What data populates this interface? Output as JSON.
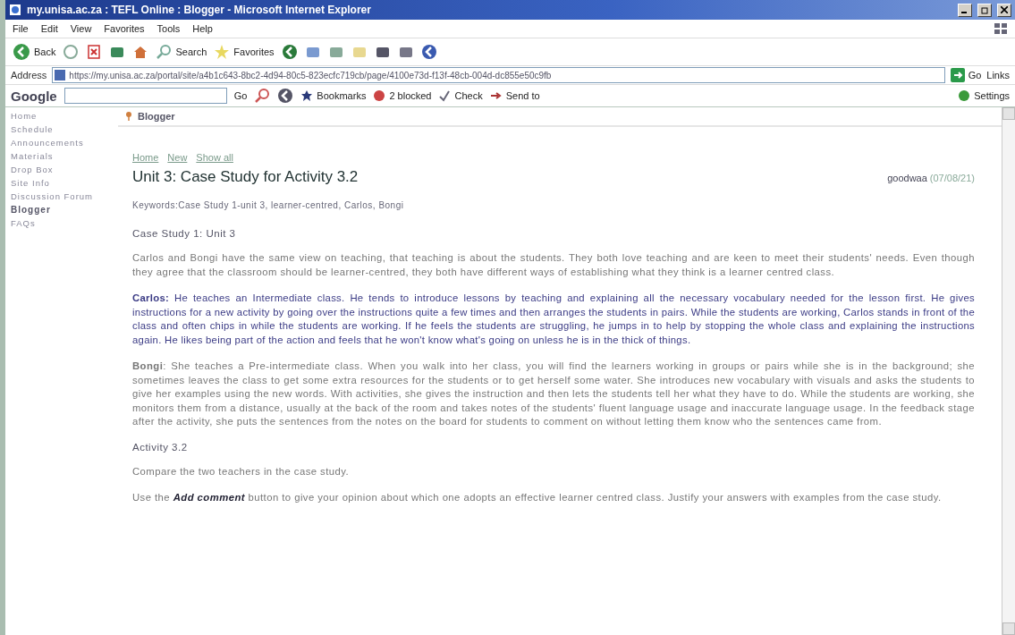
{
  "window": {
    "title": "my.unisa.ac.za : TEFL Online : Blogger - Microsoft Internet Explorer"
  },
  "menu": [
    "File",
    "Edit",
    "View",
    "Favorites",
    "Tools",
    "Help"
  ],
  "toolbar": {
    "back": "Back",
    "search": "Search",
    "favorites": "Favorites"
  },
  "address": {
    "label": "Address",
    "value": "https://my.unisa.ac.za/portal/site/a4b1c643-8bc2-4d94-80c5-823ecfc719cb/page/4100e73d-f13f-48cb-004d-dc855e50c9fb",
    "go": "Go",
    "links": "Links"
  },
  "google_bar": {
    "logo": "Google",
    "go": "Go",
    "bookmarks": "Bookmarks",
    "blocked": "2 blocked",
    "check": "Check",
    "send_to": "Send to",
    "settings": "Settings"
  },
  "sidebar": {
    "items": [
      {
        "label": "Home",
        "selected": false
      },
      {
        "label": "Schedule",
        "selected": false
      },
      {
        "label": "Announcements",
        "selected": false
      },
      {
        "label": "Materials",
        "selected": false
      },
      {
        "label": "Drop Box",
        "selected": false
      },
      {
        "label": "Site Info",
        "selected": false
      },
      {
        "label": "Discussion Forum",
        "selected": false
      },
      {
        "label": "Blogger",
        "selected": true
      },
      {
        "label": "FAQs",
        "selected": false
      }
    ]
  },
  "tool_title": "Blogger",
  "nav_links": [
    "Home",
    "New",
    "Show all"
  ],
  "post": {
    "title": "Unit 3: Case Study for Activity 3.2",
    "author": "goodwaa",
    "date": "(07/08/21)",
    "keywords": "Keywords:Case Study 1-unit 3, learner-centred, Carlos, Bongi",
    "body": [
      {
        "kind": "heading",
        "text": "Case Study 1: Unit 3"
      },
      {
        "kind": "text",
        "text": "Carlos and Bongi have the same view on teaching, that teaching is about the students. They both love teaching and are keen to meet their students' needs. Even though they agree that the classroom should be learner-centred, they both have different ways of establishing what they think is a learner centred class."
      },
      {
        "kind": "highlight",
        "text": "**Carlos:** He teaches an Intermediate class. He tends to introduce lessons by teaching and explaining all the necessary vocabulary needed for the lesson first. He gives instructions for a new activity by going over the instructions quite a few times and then arranges the students in pairs. While the students are working, Carlos stands in front of the class and often chips in while the students are working. If he feels the students are struggling, he jumps in to help by stopping the whole class and explaining the instructions again. He likes being part of the action and feels that he won't know what's going on unless he is in the thick of things."
      },
      {
        "kind": "text",
        "text": "**Bongi**: She teaches a Pre-intermediate class. When you walk into her class, you will find the learners working in groups or pairs while she is in the background; she sometimes leaves the class to get some extra resources for the students or to get herself some water. She introduces new vocabulary with visuals and asks the students to give her examples using the new words. With activities, she gives the instruction and then lets the students tell her what they have to do. While the students are working, she monitors them from a distance, usually at the back of the room and takes notes of the students' fluent language usage and inaccurate language usage. In the feedback stage after the activity, she puts the sentences from the notes on the board for students to comment on without letting them know who the sentences came from."
      },
      {
        "kind": "heading",
        "text": "Activity 3.2"
      },
      {
        "kind": "text",
        "text": "Compare the two teachers in the case study."
      },
      {
        "kind": "text",
        "text": "Use the *Add comment* button to give your opinion about which one adopts an effective learner centred class. Justify your answers with examples from the case study."
      }
    ]
  }
}
